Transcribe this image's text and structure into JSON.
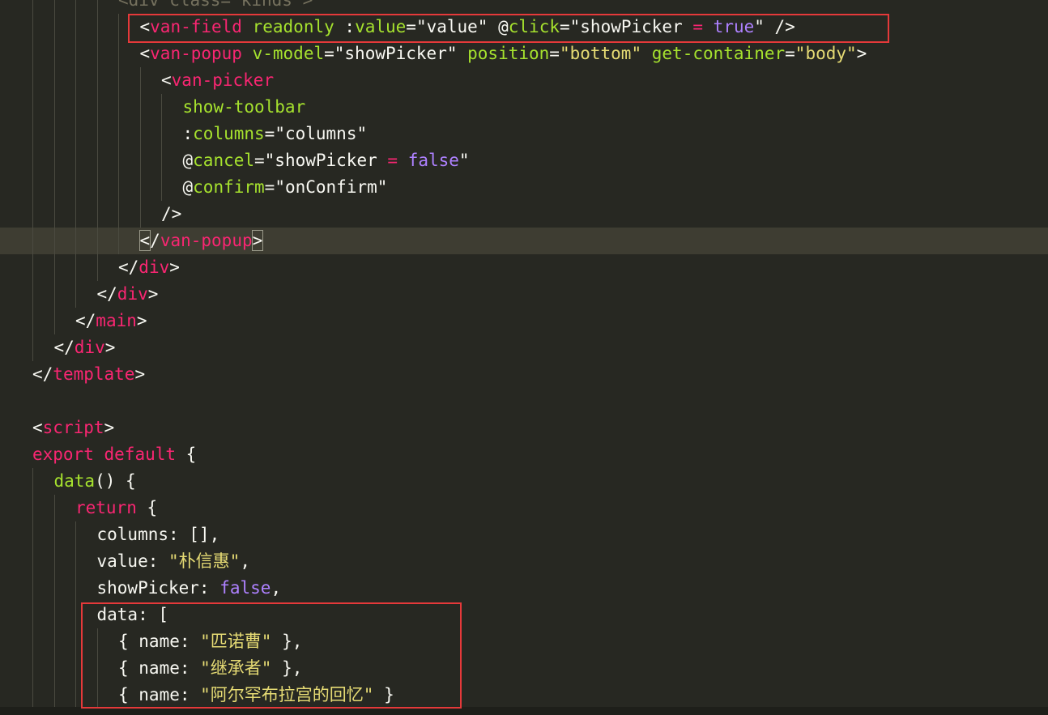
{
  "editor": {
    "lines": [
      {
        "indent": 5,
        "tokens": [
          [
            "faded",
            "<div class=\"kinds\">"
          ]
        ],
        "clip": true
      },
      {
        "indent": 6,
        "tokens": [
          [
            "punct",
            "<"
          ],
          [
            "tag",
            "van-field"
          ],
          [
            "punct",
            " "
          ],
          [
            "attr",
            "readonly"
          ],
          [
            "punct",
            " :"
          ],
          [
            "attr",
            "value"
          ],
          [
            "punct",
            "="
          ],
          [
            "punct",
            "\"value\""
          ],
          [
            "punct",
            " "
          ],
          [
            "punct",
            "@"
          ],
          [
            "attr",
            "click"
          ],
          [
            "punct",
            "=\""
          ],
          [
            "punct",
            "showPicker "
          ],
          [
            "kw",
            "="
          ],
          [
            "punct",
            " "
          ],
          [
            "const",
            "true"
          ],
          [
            "punct",
            "\" />"
          ]
        ]
      },
      {
        "indent": 6,
        "tokens": [
          [
            "punct",
            "<"
          ],
          [
            "tag",
            "van-popup"
          ],
          [
            "punct",
            " "
          ],
          [
            "attr",
            "v-model"
          ],
          [
            "punct",
            "=\"showPicker\" "
          ],
          [
            "attr",
            "position"
          ],
          [
            "punct",
            "="
          ],
          [
            "string",
            "\"bottom\""
          ],
          [
            "punct",
            " "
          ],
          [
            "attr",
            "get-container"
          ],
          [
            "punct",
            "="
          ],
          [
            "string",
            "\"body\""
          ],
          [
            "punct",
            ">"
          ]
        ]
      },
      {
        "indent": 7,
        "tokens": [
          [
            "punct",
            "<"
          ],
          [
            "tag",
            "van-picker"
          ]
        ]
      },
      {
        "indent": 8,
        "tokens": [
          [
            "attr",
            "show-toolbar"
          ]
        ]
      },
      {
        "indent": 8,
        "tokens": [
          [
            "punct",
            ":"
          ],
          [
            "attr",
            "columns"
          ],
          [
            "punct",
            "=\"columns\""
          ]
        ]
      },
      {
        "indent": 8,
        "tokens": [
          [
            "punct",
            "@"
          ],
          [
            "attr",
            "cancel"
          ],
          [
            "punct",
            "=\"showPicker "
          ],
          [
            "kw",
            "="
          ],
          [
            "punct",
            " "
          ],
          [
            "const",
            "false"
          ],
          [
            "punct",
            "\""
          ]
        ]
      },
      {
        "indent": 8,
        "tokens": [
          [
            "punct",
            "@"
          ],
          [
            "attr",
            "confirm"
          ],
          [
            "punct",
            "=\"onConfirm\""
          ]
        ]
      },
      {
        "indent": 7,
        "tokens": [
          [
            "punct",
            "/>"
          ]
        ]
      },
      {
        "indent": 6,
        "current": true,
        "tokens": [
          [
            "box",
            "<"
          ],
          [
            "punct",
            "/"
          ],
          [
            "tag",
            "van-popup"
          ],
          [
            "box",
            ">"
          ]
        ]
      },
      {
        "indent": 5,
        "tokens": [
          [
            "punct",
            "</"
          ],
          [
            "tag",
            "div"
          ],
          [
            "punct",
            ">"
          ]
        ]
      },
      {
        "indent": 4,
        "tokens": [
          [
            "punct",
            "</"
          ],
          [
            "tag",
            "div"
          ],
          [
            "punct",
            ">"
          ]
        ]
      },
      {
        "indent": 3,
        "tokens": [
          [
            "punct",
            "</"
          ],
          [
            "tag",
            "main"
          ],
          [
            "punct",
            ">"
          ]
        ]
      },
      {
        "indent": 2,
        "tokens": [
          [
            "punct",
            "</"
          ],
          [
            "tag",
            "div"
          ],
          [
            "punct",
            ">"
          ]
        ]
      },
      {
        "indent": 1,
        "tokens": [
          [
            "punct",
            "</"
          ],
          [
            "tag",
            "template"
          ],
          [
            "punct",
            ">"
          ]
        ]
      },
      {
        "indent": 1,
        "tokens": []
      },
      {
        "indent": 1,
        "tokens": [
          [
            "punct",
            "<"
          ],
          [
            "tag",
            "script"
          ],
          [
            "punct",
            ">"
          ]
        ]
      },
      {
        "indent": 1,
        "tokens": [
          [
            "kw",
            "export"
          ],
          [
            "punct",
            " "
          ],
          [
            "kw",
            "default"
          ],
          [
            "punct",
            " {"
          ]
        ]
      },
      {
        "indent": 2,
        "tokens": [
          [
            "fn",
            "data"
          ],
          [
            "punct",
            "() {"
          ]
        ]
      },
      {
        "indent": 3,
        "tokens": [
          [
            "kw",
            "return"
          ],
          [
            "punct",
            " {"
          ]
        ]
      },
      {
        "indent": 4,
        "tokens": [
          [
            "punct",
            "columns: [],"
          ]
        ]
      },
      {
        "indent": 4,
        "tokens": [
          [
            "punct",
            "value: "
          ],
          [
            "string",
            "\"朴信惠\""
          ],
          [
            "punct",
            ","
          ]
        ]
      },
      {
        "indent": 4,
        "tokens": [
          [
            "punct",
            "showPicker: "
          ],
          [
            "const",
            "false"
          ],
          [
            "punct",
            ","
          ]
        ]
      },
      {
        "indent": 4,
        "tokens": [
          [
            "punct",
            "data: ["
          ]
        ]
      },
      {
        "indent": 5,
        "tokens": [
          [
            "punct",
            "{ name: "
          ],
          [
            "string",
            "\"匹诺曹\""
          ],
          [
            "punct",
            " },"
          ]
        ]
      },
      {
        "indent": 5,
        "tokens": [
          [
            "punct",
            "{ name: "
          ],
          [
            "string",
            "\"继承者\""
          ],
          [
            "punct",
            " },"
          ]
        ]
      },
      {
        "indent": 5,
        "tokens": [
          [
            "punct",
            "{ name: "
          ],
          [
            "string",
            "\"阿尔罕布拉宫的回忆\""
          ],
          [
            "punct",
            " }"
          ]
        ]
      }
    ]
  },
  "colors": {
    "background": "#272822",
    "tag": "#f92672",
    "attribute": "#a6e22e",
    "string": "#e6db74",
    "constant": "#ae81ff",
    "highlight_box": "#e5393a"
  }
}
